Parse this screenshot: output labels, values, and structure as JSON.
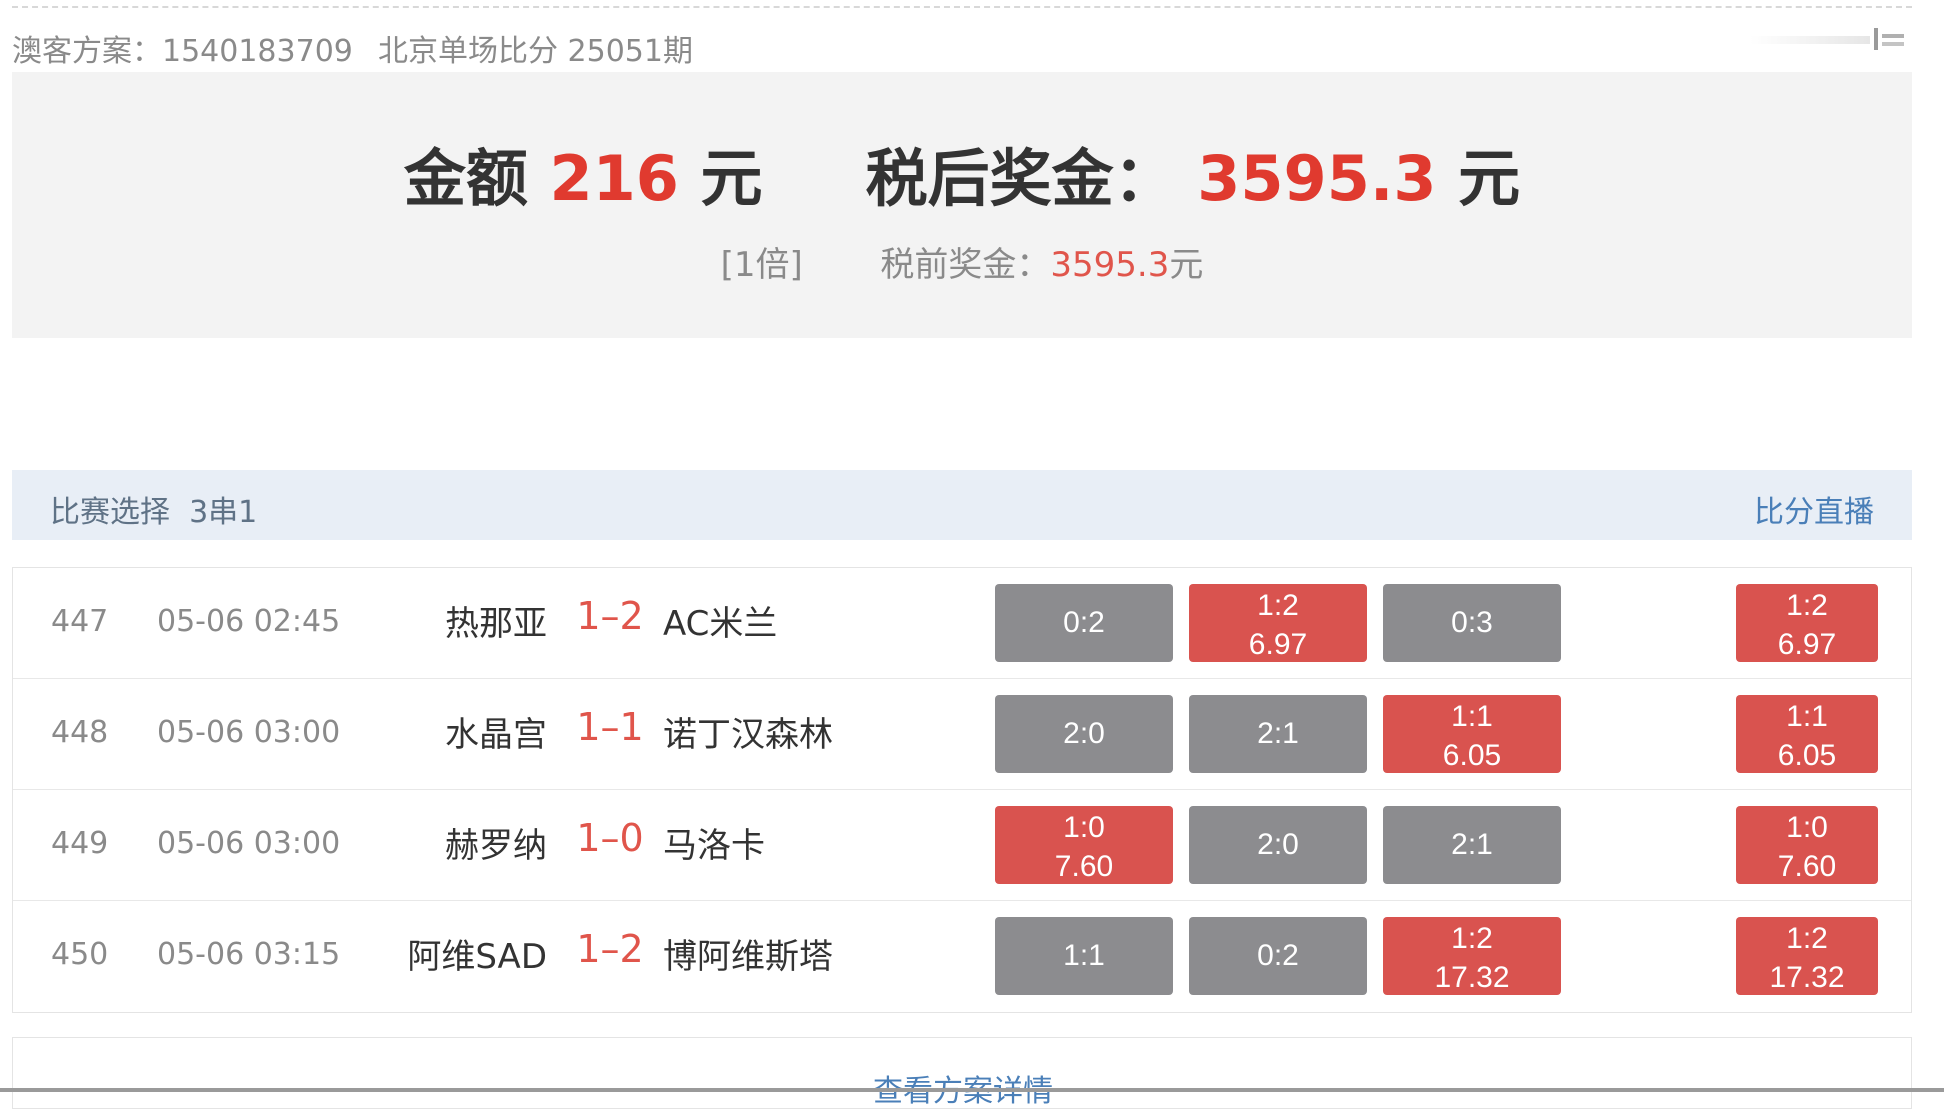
{
  "header": {
    "plan_label": "澳客方案：1540183709",
    "issue_label": "北京单场比分 25051期"
  },
  "summary": {
    "amount_label": "金额",
    "amount_value": "216",
    "amount_unit": "元",
    "prize_label": "税后奖金：",
    "prize_value": "3595.3",
    "prize_unit": "元",
    "multiple": "[1倍]",
    "pre_tax_label": "税前奖金：",
    "pre_tax_value": "3595.3",
    "pre_tax_unit": "元"
  },
  "match_header": {
    "title": "比赛选择",
    "pass_type": "3串1",
    "live_link": "比分直播"
  },
  "matches": [
    {
      "num": "447",
      "time": "05-06 02:45",
      "home": "热那亚",
      "score": "1–2",
      "away": "AC米兰",
      "picks": [
        {
          "score": "0:2",
          "odds": "",
          "hit": false
        },
        {
          "score": "1:2",
          "odds": "6.97",
          "hit": true
        },
        {
          "score": "0:3",
          "odds": "",
          "hit": false
        }
      ],
      "result": {
        "score": "1:2",
        "odds": "6.97"
      }
    },
    {
      "num": "448",
      "time": "05-06 03:00",
      "home": "水晶宫",
      "score": "1–1",
      "away": "诺丁汉森林",
      "picks": [
        {
          "score": "2:0",
          "odds": "",
          "hit": false
        },
        {
          "score": "2:1",
          "odds": "",
          "hit": false
        },
        {
          "score": "1:1",
          "odds": "6.05",
          "hit": true
        }
      ],
      "result": {
        "score": "1:1",
        "odds": "6.05"
      }
    },
    {
      "num": "449",
      "time": "05-06 03:00",
      "home": "赫罗纳",
      "score": "1–0",
      "away": "马洛卡",
      "picks": [
        {
          "score": "1:0",
          "odds": "7.60",
          "hit": true
        },
        {
          "score": "2:0",
          "odds": "",
          "hit": false
        },
        {
          "score": "2:1",
          "odds": "",
          "hit": false
        }
      ],
      "result": {
        "score": "1:0",
        "odds": "7.60"
      }
    },
    {
      "num": "450",
      "time": "05-06 03:15",
      "home": "阿维SAD",
      "score": "1–2",
      "away": "博阿维斯塔",
      "picks": [
        {
          "score": "1:1",
          "odds": "",
          "hit": false
        },
        {
          "score": "0:2",
          "odds": "",
          "hit": false
        },
        {
          "score": "1:2",
          "odds": "17.32",
          "hit": true
        }
      ],
      "result": {
        "score": "1:2",
        "odds": "17.32"
      }
    }
  ],
  "footer": {
    "detail_link": "查看方案详情"
  },
  "colors": {
    "accent_red": "#e03a2f",
    "hit_red": "#d9534f",
    "miss_gray": "#8c8c8f",
    "link_blue": "#4a7fb8"
  }
}
